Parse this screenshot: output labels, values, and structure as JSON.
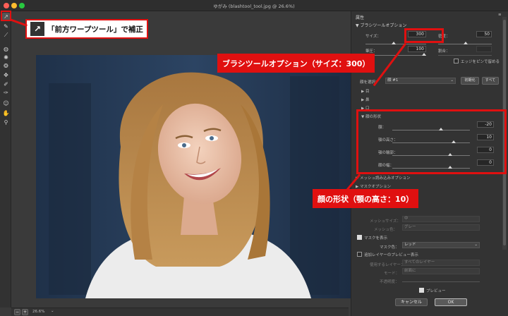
{
  "window": {
    "title": "ゆがみ (blashtool_tool.jpg @ 26.6%)",
    "zoom": "26.6%"
  },
  "toolbar": {
    "tools": [
      {
        "name": "forward-warp-icon",
        "glyph": "↗"
      },
      {
        "name": "reconstruct-icon",
        "glyph": "✎"
      },
      {
        "name": "smooth-icon",
        "glyph": "⟋"
      },
      {
        "name": "twirl-icon",
        "glyph": "◍"
      },
      {
        "name": "pucker-icon",
        "glyph": "✺"
      },
      {
        "name": "bloat-icon",
        "glyph": "❂"
      },
      {
        "name": "push-left-icon",
        "glyph": "✥"
      },
      {
        "name": "freeze-mask-icon",
        "glyph": "✐"
      },
      {
        "name": "thaw-mask-icon",
        "glyph": "✑"
      },
      {
        "name": "face-tool-icon",
        "glyph": "☺"
      },
      {
        "name": "hand-icon",
        "glyph": "✋"
      },
      {
        "name": "zoom-icon",
        "glyph": "⚲"
      }
    ]
  },
  "panel": {
    "header": "属性",
    "brush_section": "ブラシツールオプション",
    "size_label": "サイズ：",
    "size_value": "300",
    "density_label": "密度：",
    "density_value": "50",
    "pressure_label": "筆圧：",
    "pressure_value": "100",
    "rate_label": "割合：",
    "pin_edges_label": "エッジをピンで留める",
    "face_select_label": "顔を選択：",
    "face_select_value": "顔 #1",
    "reset_label": "初期化",
    "all_label": "すべて",
    "eyes_label": "目",
    "nose_label": "鼻",
    "mouth_label": "口",
    "face_shape_section": "顔の形状",
    "forehead_label": "額：",
    "forehead_value": "-20",
    "chin_height_label": "顎の高さ：",
    "chin_height_value": "10",
    "jawline_label": "顎の輪郭：",
    "jawline_value": "0",
    "face_width_label": "顔の幅：",
    "face_width_value": "0",
    "load_mesh_section": "メッシュ読み込みオプション",
    "mask_options_section": "マスクオプション",
    "mesh_size_label": "メッシュサイズ：",
    "mesh_size_value": "中",
    "mesh_color_label": "メッシュ色：",
    "mesh_color_value": "グレー",
    "show_mask_label": "マスクを表示",
    "mask_color_label": "マスク色：",
    "mask_color_value": "レッド",
    "show_backdrop_label": "追加レイヤーのプレビュー表示",
    "use_layer_label": "使用するレイヤー：",
    "use_layer_value": "すべてのレイヤー",
    "mode_label": "モード：",
    "mode_value": "前面に",
    "opacity_label": "不透明度：",
    "preview_label": "プレビュー",
    "cancel_label": "キャンセル",
    "ok_label": "OK"
  },
  "callouts": {
    "forward_warp": "「前方ワープツール」で補正",
    "brush_size": "ブラシツールオプション（サイズ：300）",
    "chin_height": "顔の形状（顎の高さ：10）"
  },
  "colors": {
    "accent_red": "#e01010",
    "panel_bg": "#333333"
  }
}
